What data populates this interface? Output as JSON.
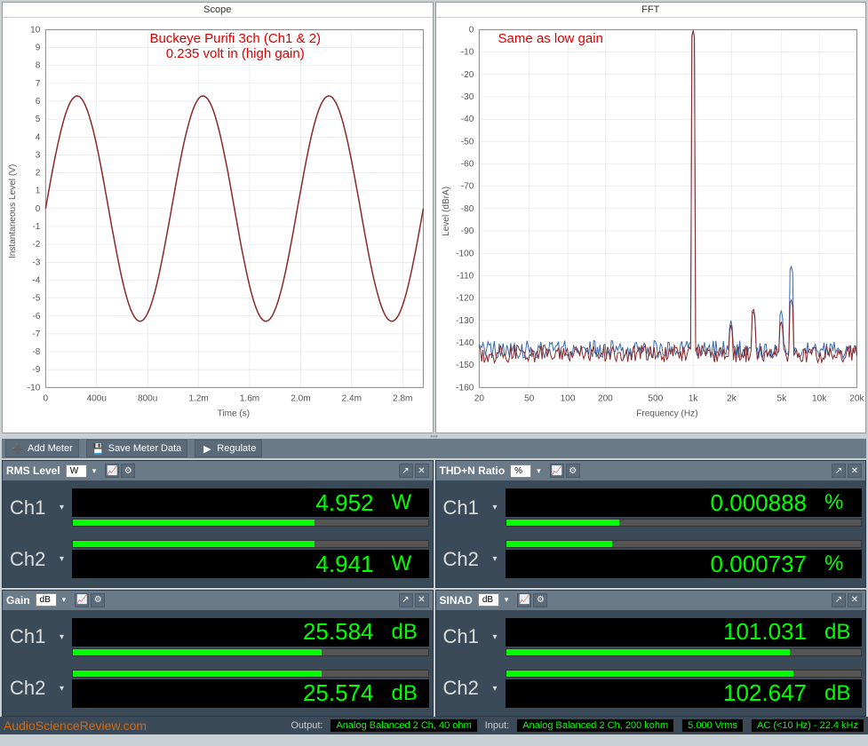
{
  "charts": {
    "scope": {
      "title": "Scope",
      "annotation_line1": "Buckeye Purifi 3ch (Ch1 & 2)",
      "annotation_line2": "0.235 volt in (high gain)",
      "xlabel": "Time (s)",
      "ylabel": "Instantaneous Level (V)"
    },
    "fft": {
      "title": "FFT",
      "annotation": "Same as low gain",
      "xlabel": "Frequency (Hz)",
      "ylabel": "Level (dBrA)"
    }
  },
  "chart_data": [
    {
      "type": "line",
      "title": "Scope",
      "xlabel": "Time (s)",
      "ylabel": "Instantaneous Level (V)",
      "xlim": [
        0,
        0.003
      ],
      "ylim": [
        -10,
        10
      ],
      "xticks": [
        "0",
        "400u",
        "800u",
        "1.2m",
        "1.6m",
        "2.0m",
        "2.4m",
        "2.8m"
      ],
      "yticks": [
        -10,
        -9,
        -8,
        -7,
        -6,
        -5,
        -4,
        -3,
        -2,
        -1,
        0,
        1,
        2,
        3,
        4,
        5,
        6,
        7,
        8,
        9,
        10
      ],
      "series": [
        {
          "name": "Ch1",
          "frequency_hz": 1000,
          "amplitude_v": 6.3,
          "color": "#8a2a2a"
        },
        {
          "name": "Ch2",
          "frequency_hz": 1000,
          "amplitude_v": 6.3,
          "color": "#3a6aa8"
        }
      ]
    },
    {
      "type": "line",
      "title": "FFT",
      "xlabel": "Frequency (Hz)",
      "ylabel": "Level (dBrA)",
      "xscale": "log",
      "xlim": [
        20,
        20000
      ],
      "ylim": [
        -160,
        0
      ],
      "xticks": [
        20,
        50,
        100,
        200,
        500,
        "1k",
        "2k",
        "5k",
        "10k",
        "20k"
      ],
      "yticks": [
        0,
        -10,
        -20,
        -30,
        -40,
        -50,
        -60,
        -70,
        -80,
        -90,
        -100,
        -110,
        -120,
        -130,
        -140,
        -150,
        -160
      ],
      "series": [
        {
          "name": "Ch1",
          "color": "#3a6aa8",
          "noise_floor_db": -143,
          "peaks": [
            {
              "f": 1000,
              "db": 0
            },
            {
              "f": 2000,
              "db": -130
            },
            {
              "f": 3000,
              "db": -125
            },
            {
              "f": 5000,
              "db": -125
            },
            {
              "f": 6000,
              "db": -105
            }
          ]
        },
        {
          "name": "Ch2",
          "color": "#8a2a2a",
          "noise_floor_db": -145,
          "peaks": [
            {
              "f": 1000,
              "db": 0
            },
            {
              "f": 2000,
              "db": -132
            },
            {
              "f": 3000,
              "db": -124
            },
            {
              "f": 5000,
              "db": -130
            },
            {
              "f": 6000,
              "db": -120
            }
          ]
        }
      ]
    }
  ],
  "toolbar": {
    "add_meter": "Add Meter",
    "save_meter": "Save Meter Data",
    "regulate": "Regulate"
  },
  "meters": {
    "rms": {
      "name": "RMS Level",
      "unit_sel": "W",
      "ch1": {
        "label": "Ch1",
        "value": "4.952",
        "unit": "W",
        "bar": 68
      },
      "ch2": {
        "label": "Ch2",
        "value": "4.941",
        "unit": "W",
        "bar": 68
      }
    },
    "thdn": {
      "name": "THD+N Ratio",
      "unit_sel": "%",
      "ch1": {
        "label": "Ch1",
        "value": "0.000888",
        "unit": "%",
        "bar": 32
      },
      "ch2": {
        "label": "Ch2",
        "value": "0.000737",
        "unit": "%",
        "bar": 30
      }
    },
    "gain": {
      "name": "Gain",
      "unit_sel": "dB",
      "ch1": {
        "label": "Ch1",
        "value": "25.584",
        "unit": "dB",
        "bar": 70
      },
      "ch2": {
        "label": "Ch2",
        "value": "25.574",
        "unit": "dB",
        "bar": 70
      }
    },
    "sinad": {
      "name": "SINAD",
      "unit_sel": "dB",
      "ch1": {
        "label": "Ch1",
        "value": "101.031",
        "unit": "dB",
        "bar": 80
      },
      "ch2": {
        "label": "Ch2",
        "value": "102.647",
        "unit": "dB",
        "bar": 81
      }
    }
  },
  "status": {
    "site": "AudioScienceReview.com",
    "output_label": "Output:",
    "output": "Analog Balanced 2 Ch, 40 ohm",
    "input_label": "Input:",
    "input": "Analog Balanced 2 Ch, 200 kohm",
    "vrms": "5.000 Vrms",
    "ac": "AC (<10 Hz) - 22.4 kHz"
  }
}
